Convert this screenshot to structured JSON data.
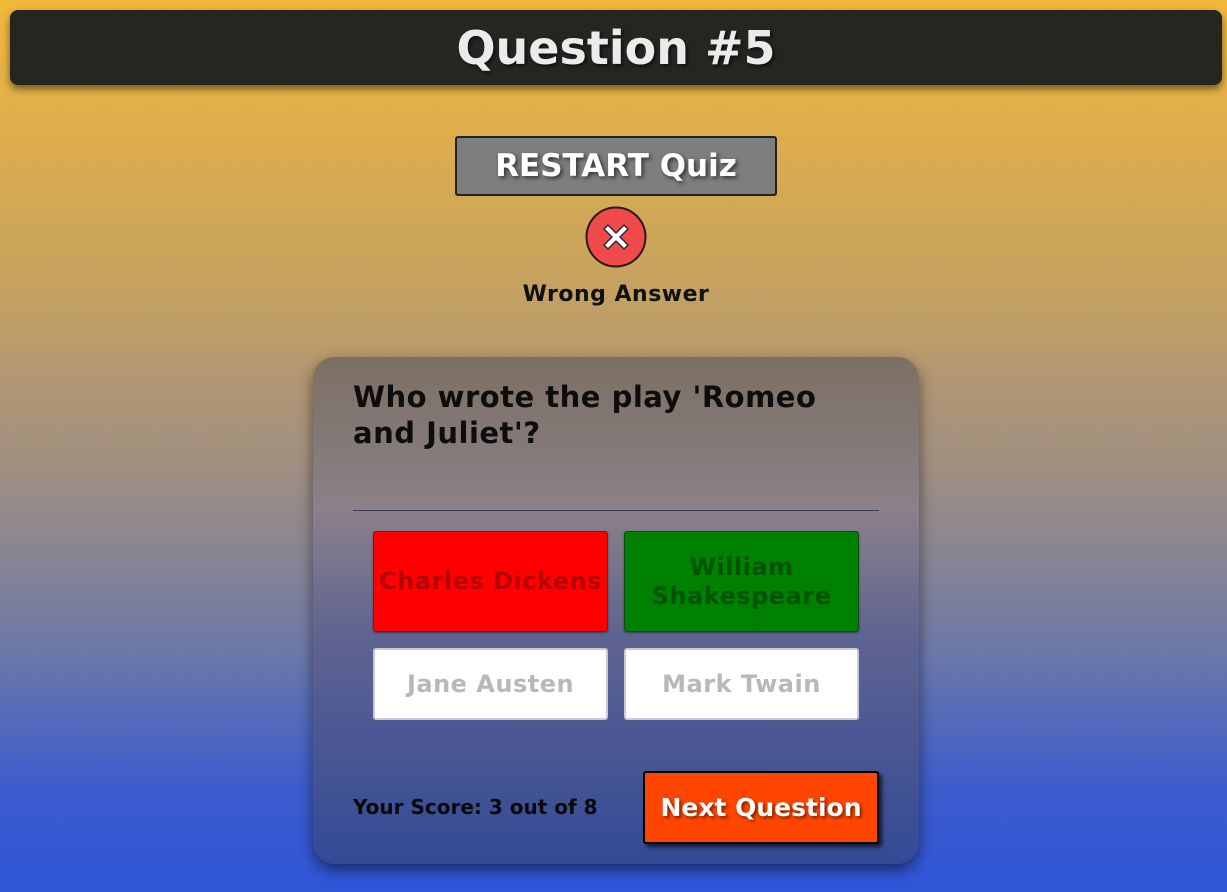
{
  "header": {
    "title": "Question #5"
  },
  "controls": {
    "restart_label": "RESTART Quiz"
  },
  "feedback": {
    "icon": "x-circle-icon",
    "text": "Wrong Answer",
    "icon_color": "#f04a4a"
  },
  "quiz": {
    "question": "Who wrote the play 'Romeo and Juliet'?",
    "answers": [
      {
        "label": "Charles Dickens",
        "state": "wrong",
        "color": "#ff0000"
      },
      {
        "label": "William Shakespeare",
        "state": "correct",
        "color": "#008000"
      },
      {
        "label": "Jane Austen",
        "state": "neutral",
        "color": "#ffffff"
      },
      {
        "label": "Mark Twain",
        "state": "neutral",
        "color": "#ffffff"
      }
    ],
    "score_text": "Your Score: 3 out of 8",
    "next_label": "Next Question",
    "next_color": "#ff4500"
  }
}
